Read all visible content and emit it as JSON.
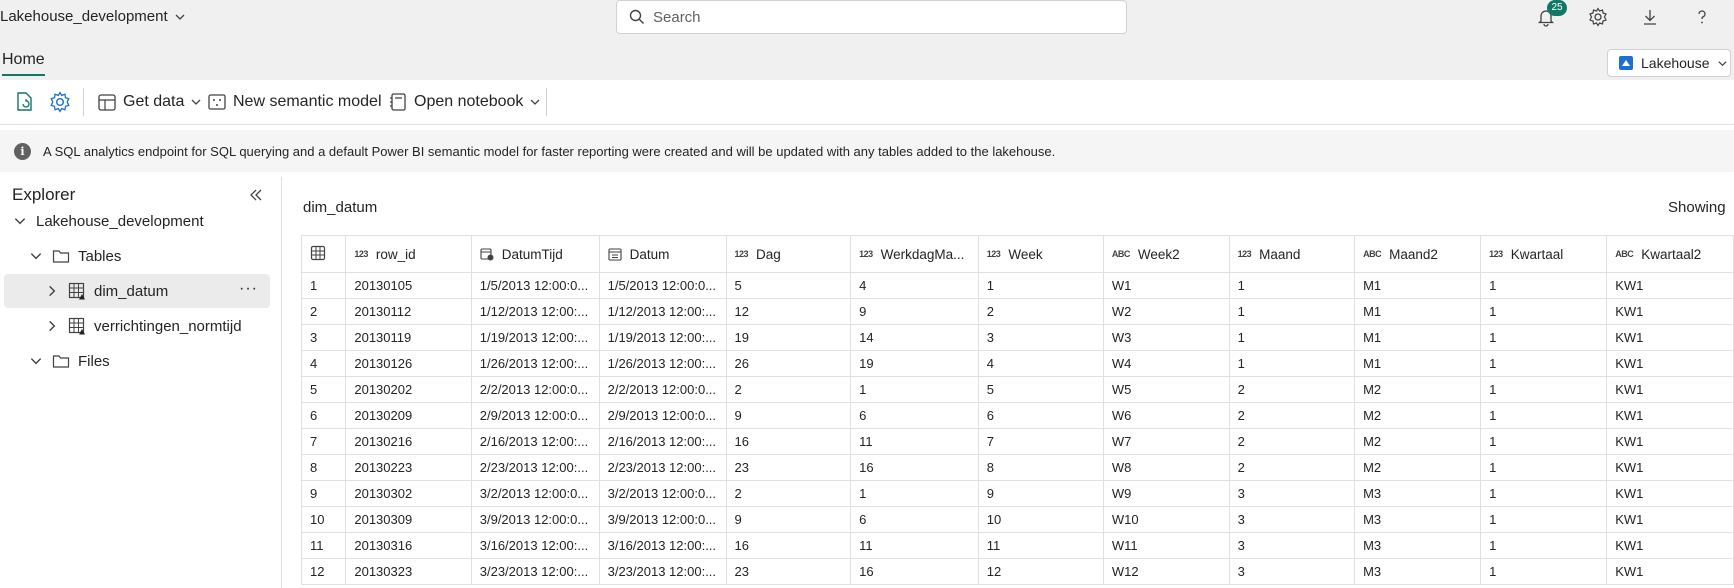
{
  "topbar": {
    "workspace": "Lakehouse_development",
    "search_placeholder": "Search",
    "notification_count": "25"
  },
  "tabs": {
    "home": "Home"
  },
  "lakehouse_button": "Lakehouse",
  "toolbar": {
    "get_data": "Get data",
    "new_semantic_model": "New semantic model",
    "open_notebook": "Open notebook"
  },
  "banner": {
    "text": "A SQL analytics endpoint for SQL querying and a default Power BI semantic model for faster reporting were created and will be updated with any tables added to the lakehouse."
  },
  "explorer": {
    "title": "Explorer",
    "root": "Lakehouse_development",
    "tables_folder": "Tables",
    "tables": [
      "dim_datum",
      "verrichtingen_normtijd"
    ],
    "files_folder": "Files"
  },
  "main": {
    "table_name": "dim_datum",
    "showing": "Showing",
    "columns": [
      {
        "type": "123",
        "name": "row_id"
      },
      {
        "type": "datetime",
        "name": "DatumTijd"
      },
      {
        "type": "date",
        "name": "Datum"
      },
      {
        "type": "123",
        "name": "Dag"
      },
      {
        "type": "123",
        "name": "WerkdagMa..."
      },
      {
        "type": "123",
        "name": "Week"
      },
      {
        "type": "ABC",
        "name": "Week2"
      },
      {
        "type": "123",
        "name": "Maand"
      },
      {
        "type": "ABC",
        "name": "Maand2"
      },
      {
        "type": "123",
        "name": "Kwartaal"
      },
      {
        "type": "ABC",
        "name": "Kwartaal2"
      }
    ],
    "rows": [
      [
        "1",
        "20130105",
        "1/5/2013 12:00:0...",
        "1/5/2013 12:00:0...",
        "5",
        "4",
        "1",
        "W1",
        "1",
        "M1",
        "1",
        "KW1"
      ],
      [
        "2",
        "20130112",
        "1/12/2013 12:00:...",
        "1/12/2013 12:00:...",
        "12",
        "9",
        "2",
        "W2",
        "1",
        "M1",
        "1",
        "KW1"
      ],
      [
        "3",
        "20130119",
        "1/19/2013 12:00:...",
        "1/19/2013 12:00:...",
        "19",
        "14",
        "3",
        "W3",
        "1",
        "M1",
        "1",
        "KW1"
      ],
      [
        "4",
        "20130126",
        "1/26/2013 12:00:...",
        "1/26/2013 12:00:...",
        "26",
        "19",
        "4",
        "W4",
        "1",
        "M1",
        "1",
        "KW1"
      ],
      [
        "5",
        "20130202",
        "2/2/2013 12:00:0...",
        "2/2/2013 12:00:0...",
        "2",
        "1",
        "5",
        "W5",
        "2",
        "M2",
        "1",
        "KW1"
      ],
      [
        "6",
        "20130209",
        "2/9/2013 12:00:0...",
        "2/9/2013 12:00:0...",
        "9",
        "6",
        "6",
        "W6",
        "2",
        "M2",
        "1",
        "KW1"
      ],
      [
        "7",
        "20130216",
        "2/16/2013 12:00:...",
        "2/16/2013 12:00:...",
        "16",
        "11",
        "7",
        "W7",
        "2",
        "M2",
        "1",
        "KW1"
      ],
      [
        "8",
        "20130223",
        "2/23/2013 12:00:...",
        "2/23/2013 12:00:...",
        "23",
        "16",
        "8",
        "W8",
        "2",
        "M2",
        "1",
        "KW1"
      ],
      [
        "9",
        "20130302",
        "3/2/2013 12:00:0...",
        "3/2/2013 12:00:0...",
        "2",
        "1",
        "9",
        "W9",
        "3",
        "M3",
        "1",
        "KW1"
      ],
      [
        "10",
        "20130309",
        "3/9/2013 12:00:0...",
        "3/9/2013 12:00:0...",
        "9",
        "6",
        "10",
        "W10",
        "3",
        "M3",
        "1",
        "KW1"
      ],
      [
        "11",
        "20130316",
        "3/16/2013 12:00:...",
        "3/16/2013 12:00:...",
        "16",
        "11",
        "11",
        "W11",
        "3",
        "M3",
        "1",
        "KW1"
      ],
      [
        "12",
        "20130323",
        "3/23/2013 12:00:...",
        "3/23/2013 12:00:...",
        "23",
        "16",
        "12",
        "W12",
        "3",
        "M3",
        "1",
        "KW1"
      ]
    ]
  }
}
